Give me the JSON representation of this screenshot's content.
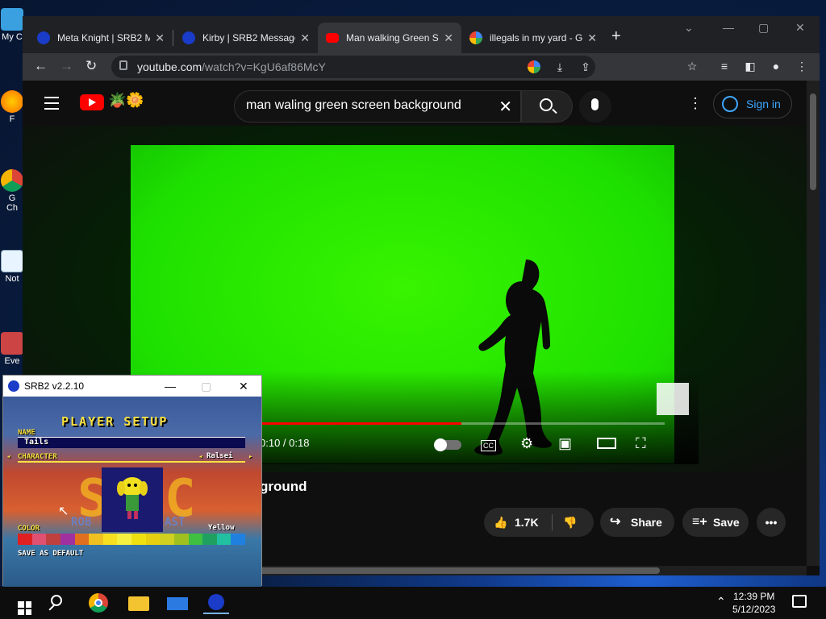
{
  "desktop": {
    "icons": [
      {
        "name": "my-computer",
        "label": "My C"
      },
      {
        "name": "firefox",
        "label": "F"
      },
      {
        "name": "chrome",
        "label": "G\nCh"
      },
      {
        "name": "notepad",
        "label": "Not"
      },
      {
        "name": "everything",
        "label": "Eve"
      }
    ]
  },
  "browser": {
    "tabs": [
      {
        "title": "Meta Knight | SRB2 M",
        "favicon": "sonic-icon",
        "active": false
      },
      {
        "title": "Kirby | SRB2 Message",
        "favicon": "sonic-icon",
        "active": false
      },
      {
        "title": "Man walking Green S",
        "favicon": "youtube-icon",
        "active": true
      },
      {
        "title": "illegals in my yard - G",
        "favicon": "google-icon",
        "active": false
      }
    ],
    "new_tab": "+",
    "url_host": "youtube.com",
    "url_path": "/watch?v=KgU6af86McY"
  },
  "youtube": {
    "search_query": "man waling green screen background",
    "sign_in": "Sign in",
    "timecode": "0:10 / 0:18",
    "video_title_partial": "ground",
    "likes": "1.7K",
    "share_label": "Share",
    "save_label": "Save",
    "progress_fraction": 0.61,
    "buffered_fraction": 1.0
  },
  "srb2": {
    "window_title": "SRB2 v2.2.10",
    "heading": "PLAYER SETUP",
    "name_label": "NAME",
    "name_value": "Tails",
    "character_label": "CHARACTER",
    "character_value": "Ralsei",
    "color_label": "COLOR",
    "color_value": "Yellow",
    "save_default": "SAVE AS DEFAULT",
    "bg_letters_left": "S",
    "bg_letters_right": "C",
    "bg_text_left": "ROB",
    "bg_text_right": "AST"
  },
  "taskbar": {
    "apps": [
      "start",
      "search",
      "chrome",
      "file-explorer",
      "mail",
      "srb2"
    ],
    "time": "12:39 PM",
    "date": "5/12/2023"
  },
  "colors": {
    "green_screen": "#22e600",
    "youtube_red": "#ff0000",
    "chrome_dark": "#202124",
    "signin_blue": "#3ea6ff",
    "srb2_yellow": "#f8e040"
  }
}
